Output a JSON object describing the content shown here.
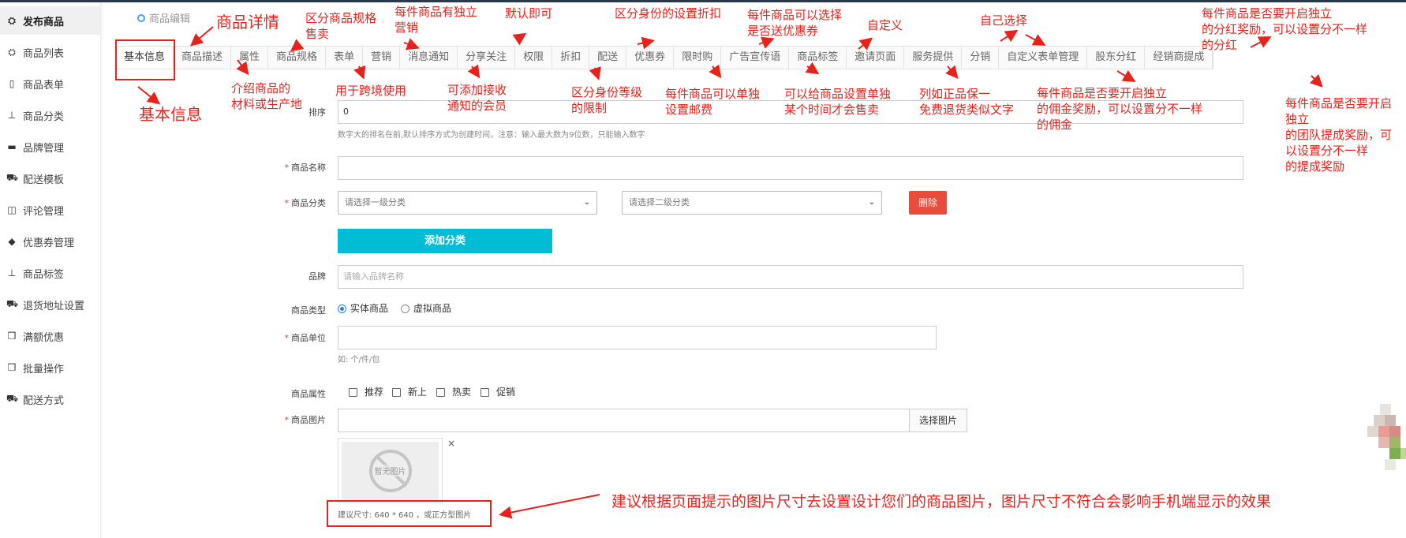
{
  "sidebar": {
    "items": [
      {
        "label": "发布商品",
        "icon": "cubes-icon",
        "glyph": "⛭",
        "active": true
      },
      {
        "label": "商品列表",
        "icon": "cubes-icon",
        "glyph": "⛭",
        "active": false
      },
      {
        "label": "商品表单",
        "icon": "file-icon",
        "glyph": "▯",
        "active": false
      },
      {
        "label": "商品分类",
        "icon": "sitemap-icon",
        "glyph": "⊥",
        "active": false
      },
      {
        "label": "品牌管理",
        "icon": "briefcase-icon",
        "glyph": "▬",
        "active": false
      },
      {
        "label": "配送模板",
        "icon": "truck-icon",
        "glyph": "⛟",
        "active": false
      },
      {
        "label": "评论管理",
        "icon": "columns-icon",
        "glyph": "◫",
        "active": false
      },
      {
        "label": "优惠券管理",
        "icon": "tags-icon",
        "glyph": "◆",
        "active": false
      },
      {
        "label": "商品标签",
        "icon": "sitemap-icon",
        "glyph": "⊥",
        "active": false
      },
      {
        "label": "退货地址设置",
        "icon": "truck-icon",
        "glyph": "⛟",
        "active": false
      },
      {
        "label": "满额优惠",
        "icon": "gift-icon",
        "glyph": "❒",
        "active": false
      },
      {
        "label": "批量操作",
        "icon": "gift-icon",
        "glyph": "❒",
        "active": false
      },
      {
        "label": "配送方式",
        "icon": "truck-icon",
        "glyph": "⛟",
        "active": false
      }
    ]
  },
  "breadcrumb": {
    "label": "商品编辑"
  },
  "tabs": [
    "基本信息",
    "商品描述",
    "属性",
    "商品规格",
    "表单",
    "营销",
    "消息通知",
    "分享关注",
    "权限",
    "折扣",
    "配送",
    "优惠券",
    "限时购",
    "广告宣传语",
    "商品标签",
    "邀请页面",
    "服务提供",
    "分销",
    "自定义表单管理",
    "股东分红",
    "经销商提成"
  ],
  "form": {
    "sort": {
      "label": "排序",
      "value": "0",
      "hint": "数字大的排名在前,默认排序方式为创建时间，注意：输入最大数为9位数，只能输入数字"
    },
    "name": {
      "label": "商品名称",
      "value": ""
    },
    "category": {
      "label": "商品分类",
      "first_placeholder": "请选择一级分类",
      "second_placeholder": "请选择二级分类",
      "delete_label": "删除",
      "add_label": "添加分类"
    },
    "brand": {
      "label": "品牌",
      "placeholder": "请输入品牌名称"
    },
    "type": {
      "label": "商品类型",
      "options": [
        "实体商品",
        "虚拟商品"
      ],
      "selected": "实体商品"
    },
    "unit": {
      "label": "商品单位",
      "value": "",
      "hint": "如: 个/件/包"
    },
    "attributes": {
      "label": "商品属性",
      "options": [
        "推荐",
        "新上",
        "热卖",
        "促销"
      ]
    },
    "image": {
      "label": "商品图片",
      "button": "选择图片",
      "no_image": "暂无图片",
      "close": "×",
      "size_hint": "建议尺寸: 640 * 640 ，或正方型图片"
    }
  },
  "annotations": {
    "product_detail": "商品详情",
    "basic_info": "基本信息",
    "spec": "区分商品规格\n售卖",
    "marketing": "每件商品有独立\n营销",
    "default": "默认即可",
    "discount": "区分身份的设置折扣",
    "coupon": "每件商品可以选择\n是否送优惠券",
    "custom": "自定义",
    "choose": "自己选择",
    "dividend": "每件商品是否要开启独立\n的分红奖励，可以设置分不一样\n的分红",
    "desc": "介绍商品的\n材料或生产地",
    "form_use": "用于跨境使用",
    "notify": "可添加接收\n通知的会员",
    "permission": "区分身份等级\n的限制",
    "delivery": "每件商品可以单独\n设置邮费",
    "flash": "可以给商品设置单独\n某个时间才会售卖",
    "tag": "列如正品保一\n免费退货类似文字",
    "commission": "每件商品是否要开启独立\n的佣金奖励，可以设置分不一样\n的佣金",
    "dealer": "每件商品是否要开启\n独立\n的团队提成奖励，可\n以设置分不一样\n的提成奖励",
    "image_tip": "建议根据页面提示的图片尺寸去设置设计您们的商品图片，图片尺寸不符合会影响手机端显示的效果"
  },
  "colors": {
    "annotation": "#e8211b",
    "primary": "#00bcd4",
    "danger": "#e74c3c",
    "radio": "#2f7ae5"
  }
}
